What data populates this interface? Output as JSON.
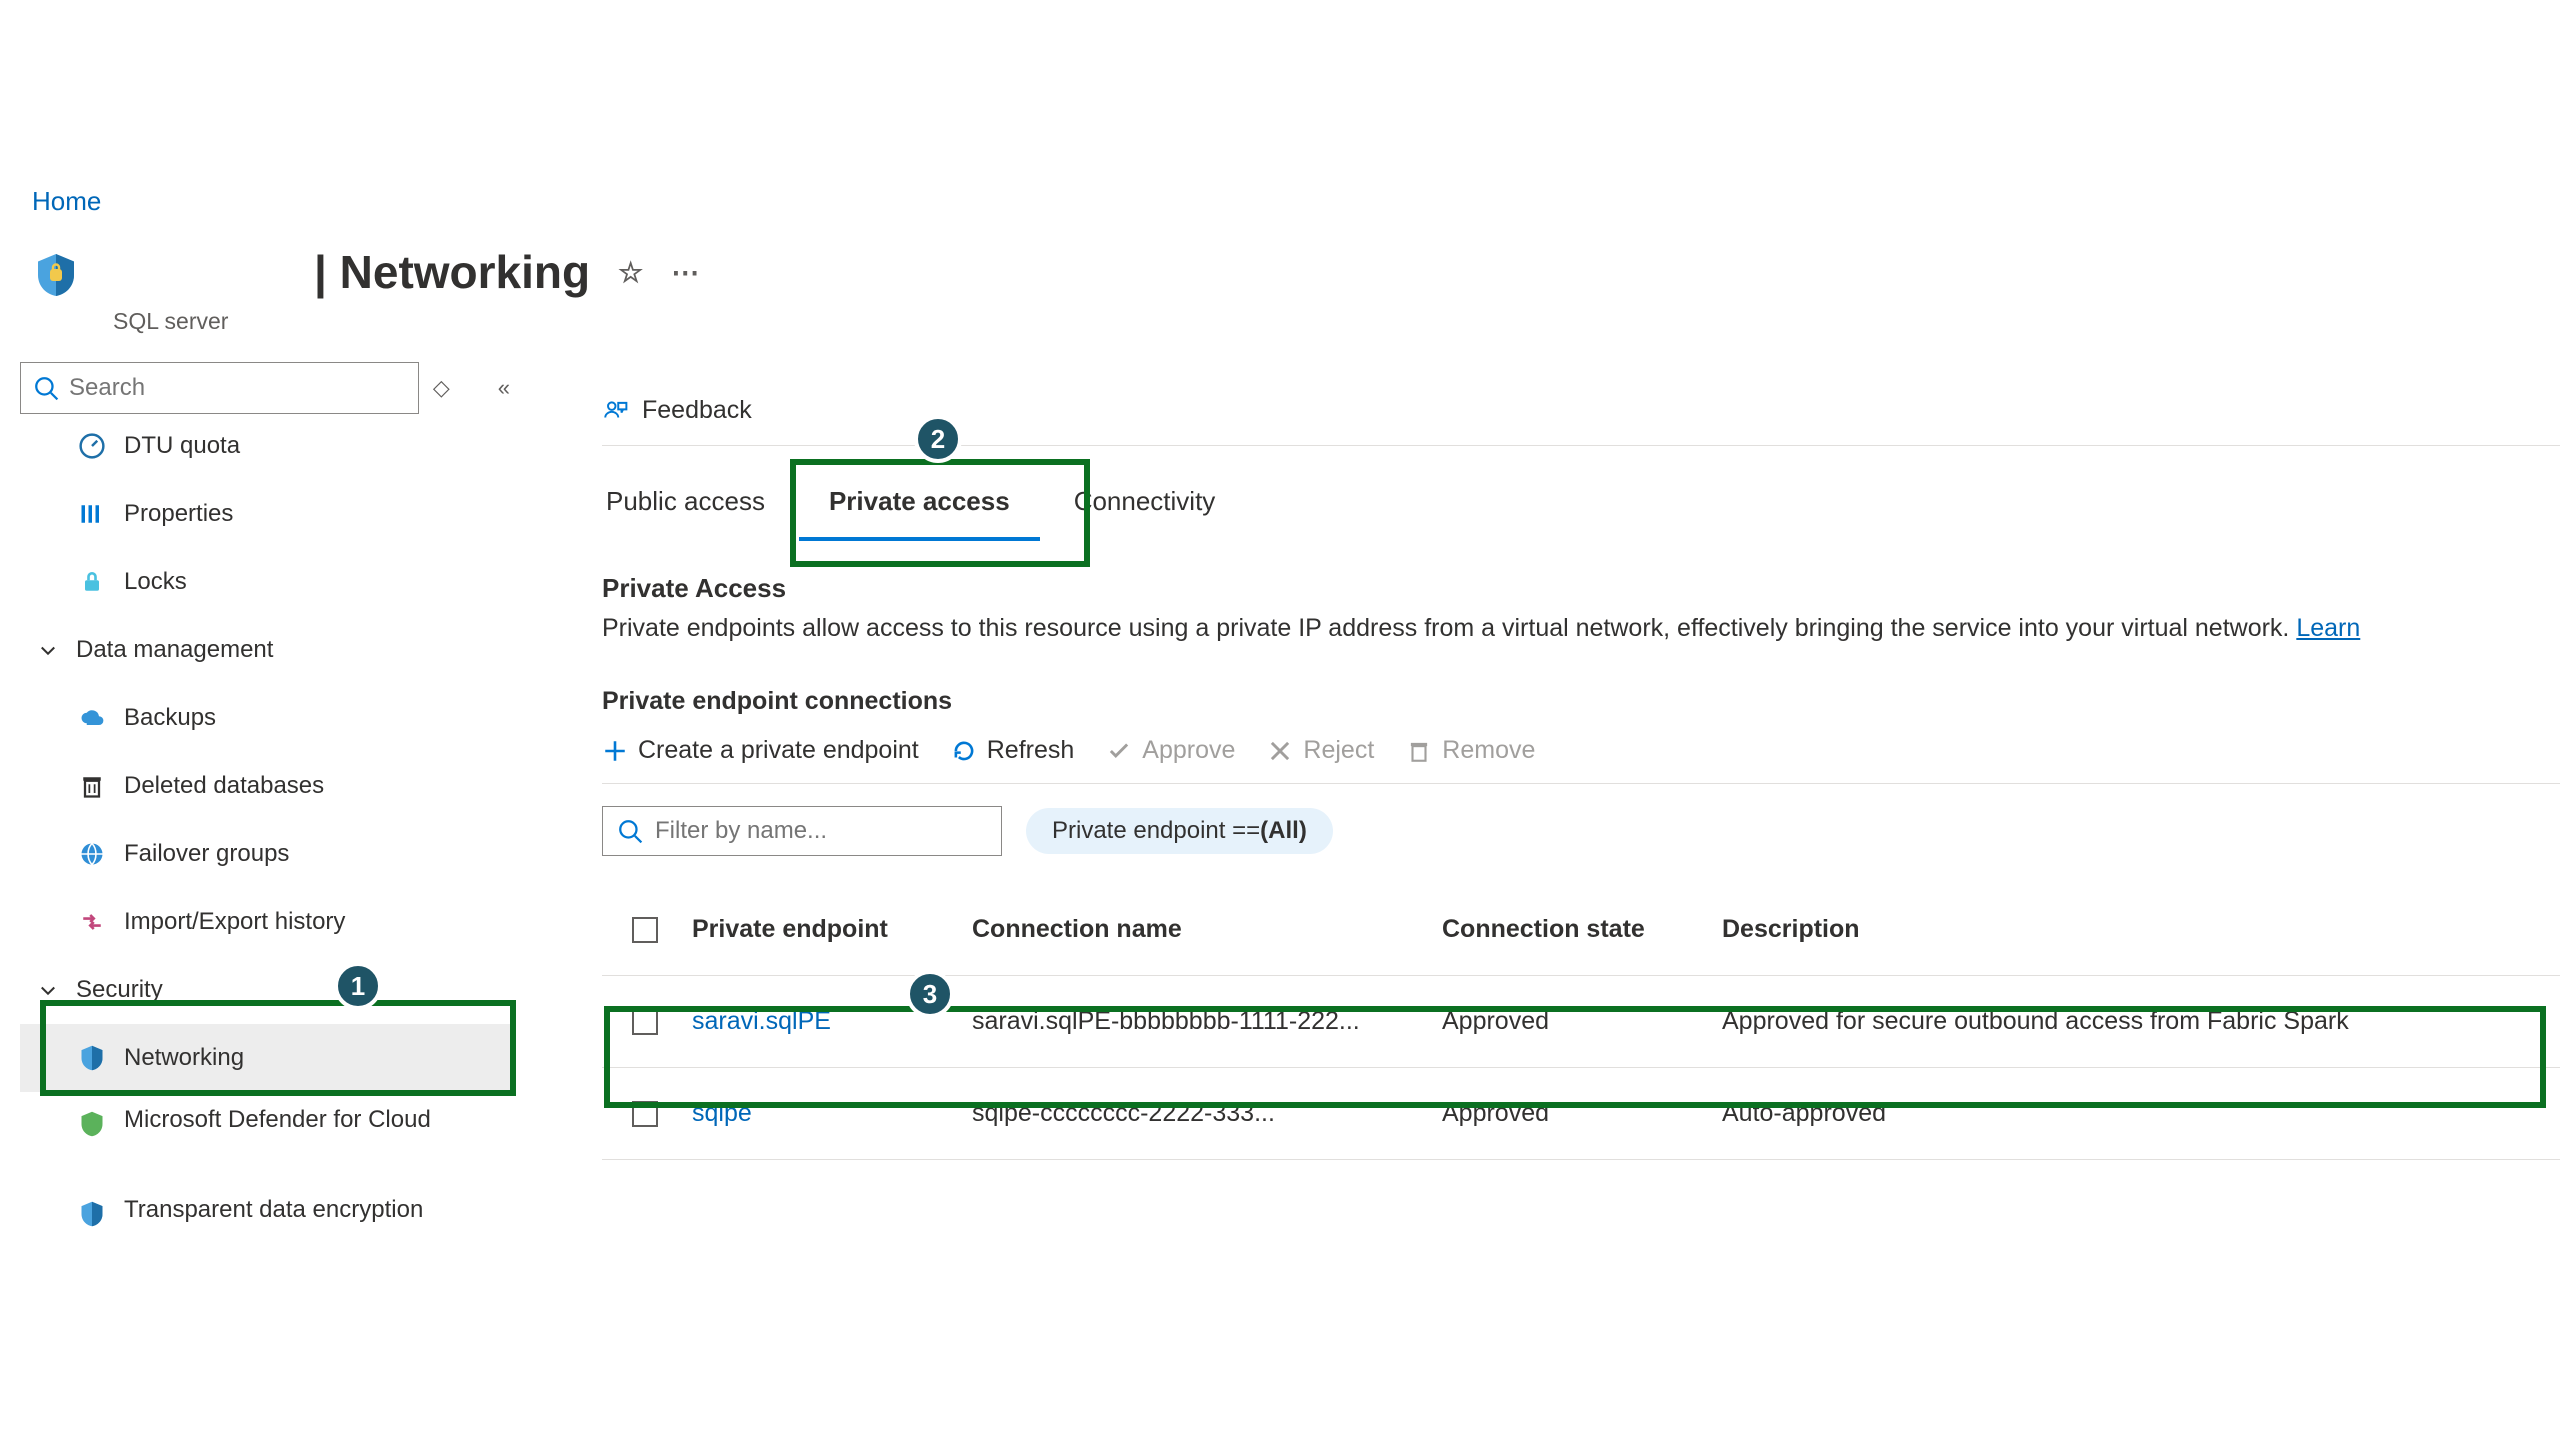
{
  "breadcrumb": {
    "home": "Home"
  },
  "header": {
    "title": "| Networking",
    "subtitle": "SQL server"
  },
  "sidebar": {
    "search_placeholder": "Search",
    "items": {
      "dtu_quota": "DTU quota",
      "properties": "Properties",
      "locks": "Locks"
    },
    "data_mgmt_label": "Data management",
    "data_items": {
      "backups": "Backups",
      "deleted_dbs": "Deleted databases",
      "failover": "Failover groups",
      "import_export": "Import/Export history"
    },
    "security_label": "Security",
    "security_items": {
      "networking": "Networking",
      "defender": "Microsoft Defender for Cloud",
      "tde": "Transparent data encryption"
    }
  },
  "toolbar": {
    "feedback": "Feedback"
  },
  "tabs": {
    "public": "Public access",
    "private": "Private access",
    "connectivity": "Connectivity"
  },
  "private_access": {
    "heading": "Private Access",
    "desc": "Private endpoints allow access to this resource using a private IP address from a virtual network, effectively bringing the service into your virtual network. ",
    "learn": "Learn",
    "subheading": "Private endpoint connections"
  },
  "actions": {
    "create": "Create a private endpoint",
    "refresh": "Refresh",
    "approve": "Approve",
    "reject": "Reject",
    "remove": "Remove"
  },
  "filters": {
    "placeholder": "Filter by name...",
    "pill_prefix": "Private endpoint == ",
    "pill_value": "(All)"
  },
  "table": {
    "cols": {
      "pe": "Private endpoint",
      "conn_name": "Connection name",
      "conn_state": "Connection state",
      "desc": "Description"
    },
    "rows": [
      {
        "pe": "saravi.sqlPE",
        "conn_name": "saravi.sqlPE-bbbbbbbb-1111-222...",
        "conn_state": "Approved",
        "desc": "Approved for secure outbound access from Fabric Spark"
      },
      {
        "pe": "sqlpe",
        "conn_name": "sqlpe-cccccccc-2222-333...",
        "conn_state": "Approved",
        "desc": "Auto-approved"
      }
    ]
  },
  "badges": {
    "one": "1",
    "two": "2",
    "three": "3"
  }
}
